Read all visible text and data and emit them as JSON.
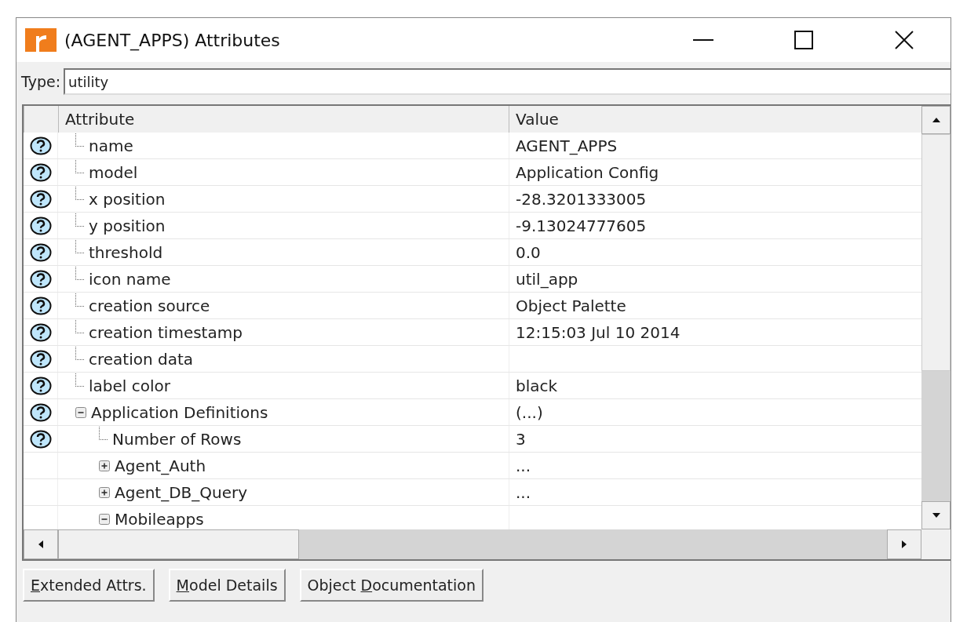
{
  "window": {
    "title": "(AGENT_APPS) Attributes"
  },
  "type_field": {
    "label": "Type:",
    "value": "utility"
  },
  "table": {
    "columns": [
      "Attribute",
      "Value"
    ],
    "rows": [
      {
        "attribute": "name",
        "value": "AGENT_APPS",
        "help": true
      },
      {
        "attribute": "model",
        "value": "Application Config",
        "help": true
      },
      {
        "attribute": "x position",
        "value": "-28.3201333005",
        "help": true
      },
      {
        "attribute": "y position",
        "value": "-9.13024777605",
        "help": true
      },
      {
        "attribute": "threshold",
        "value": "0.0",
        "help": true
      },
      {
        "attribute": "icon name",
        "value": "util_app",
        "help": true
      },
      {
        "attribute": "creation source",
        "value": "Object Palette",
        "help": true
      },
      {
        "attribute": "creation timestamp",
        "value": "12:15:03 Jul 10 2014",
        "help": true
      },
      {
        "attribute": "creation data",
        "help": true
      },
      {
        "attribute": "label color",
        "value": "black",
        "help": true
      },
      {
        "attribute": "Application Definitions",
        "value": "(...)",
        "help": true,
        "expanded": true,
        "children": [
          {
            "attribute": "Number of Rows",
            "value": "3",
            "help": true
          },
          {
            "attribute": "Agent_Auth",
            "value": "...",
            "help": false,
            "expanded": false
          },
          {
            "attribute": "Agent_DB_Query",
            "value": "...",
            "help": false,
            "expanded": false
          },
          {
            "attribute": "Mobileapps",
            "help": false,
            "expanded": true
          }
        ]
      }
    ]
  },
  "buttons": [
    {
      "key": "E",
      "after": "xtended Attrs."
    },
    {
      "key": "M",
      "after": "odel Details"
    },
    {
      "before": "Object ",
      "key": "D",
      "after": "ocumentation"
    }
  ]
}
